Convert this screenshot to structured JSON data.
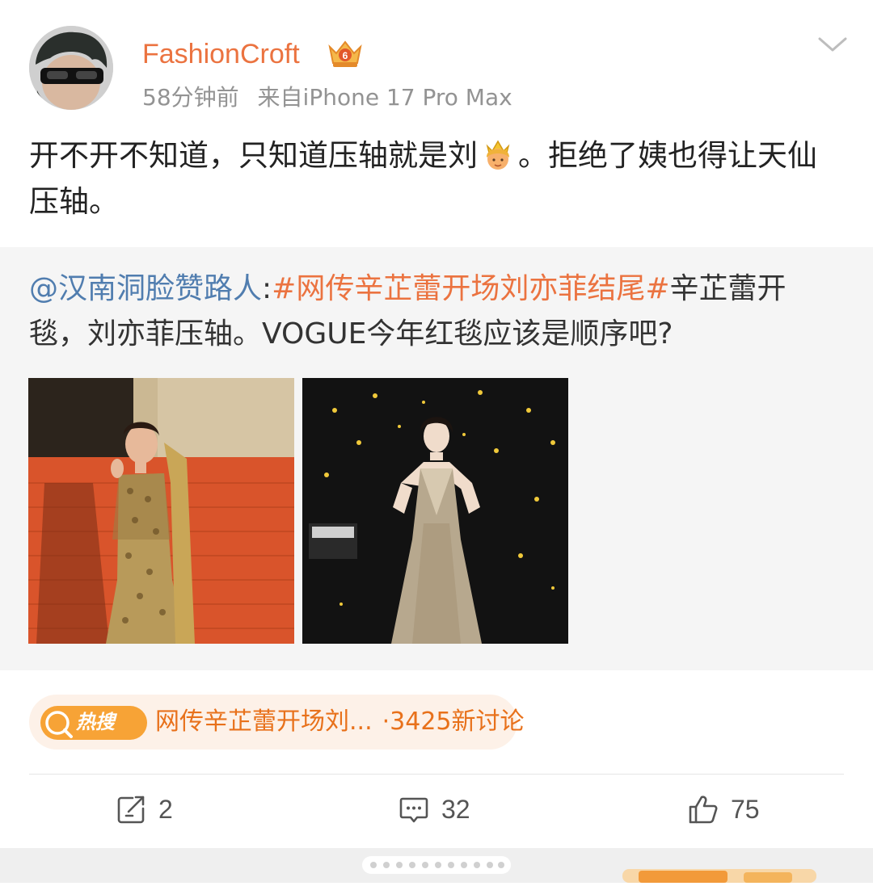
{
  "post": {
    "username": "FashionCroft",
    "time": "58分钟前",
    "source": "来自iPhone 17 Pro Max",
    "text_part1": "开不开不知道，只知道压轴就是刘",
    "text_part2": "。拒绝了姨也得让天仙压轴。"
  },
  "repost": {
    "mention": "@汉南洞脸赞路人",
    "colon": ":",
    "topic": "#网传辛芷蕾开场刘亦菲结尾#",
    "text": "辛芷蕾开毯，刘亦菲压轴。VOGUE今年红毯应该是顺序吧?"
  },
  "hot_search": {
    "badge": "热搜",
    "title": "网传辛芷蕾开场刘...",
    "count": "·3425新讨论"
  },
  "actions": {
    "repost_count": "2",
    "comment_count": "32",
    "like_count": "75"
  },
  "colors": {
    "username": "#eb7340",
    "mention": "#507daf",
    "topic": "#eb7340",
    "hot_accent": "#e8711b"
  },
  "icons": [
    "vip-crown-badge-icon",
    "chevron-down-icon",
    "crown-princess-emoji",
    "repost-icon",
    "comment-icon",
    "like-icon"
  ]
}
